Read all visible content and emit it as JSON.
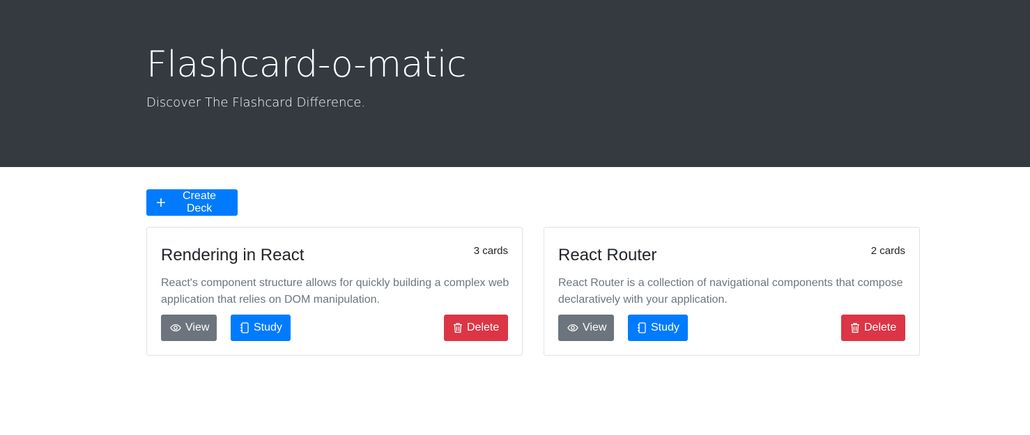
{
  "header": {
    "title": "Flashcard-o-matic",
    "subtitle": "Discover The Flashcard Difference."
  },
  "actions": {
    "create_deck_label": "Create Deck",
    "create_icon": "plus-icon"
  },
  "decks": [
    {
      "name": "Rendering in React",
      "count": "3 cards",
      "description": "React's component structure allows for quickly building a complex web application that relies on DOM manipulation.",
      "view_label": "View",
      "study_label": "Study",
      "delete_label": "Delete"
    },
    {
      "name": "React Router",
      "count": "2 cards",
      "description": "React Router is a collection of navigational components that compose declaratively with your application.",
      "view_label": "View",
      "study_label": "Study",
      "delete_label": "Delete"
    }
  ],
  "colors": {
    "header_bg": "#343a40",
    "primary": "#007bff",
    "secondary": "#6c757d",
    "danger": "#dc3545"
  }
}
